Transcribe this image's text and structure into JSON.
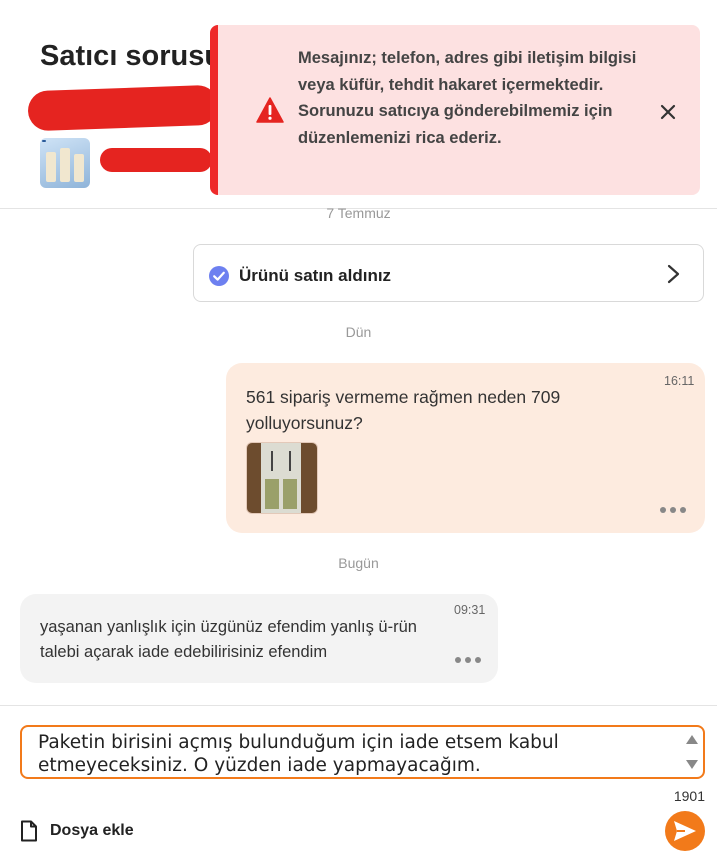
{
  "header": {
    "title": "Satıcı sorusu"
  },
  "alert": {
    "message": "Mesajınız; telefon, adres gibi iletişim bilgisi veya küfür, tehdit hakaret içermektedir. Sorunuzu satıcıya gönderebilmemiz için düzenlemenizi rica ederiz.",
    "icon": "warning-icon",
    "close_icon": "close-icon",
    "accent_color": "#ee2a2a",
    "background_color": "#fde1e1"
  },
  "conversation": {
    "dates": {
      "first": "7 Temmuz",
      "second": "Dün",
      "third": "Bugün"
    },
    "purchase": {
      "label": "Ürünü satın aldınız",
      "icon": "check-circle-icon"
    },
    "outgoing": {
      "time": "16:11",
      "text": "561 sipariş vermeme rağmen neden 709 yolluyorsunuz?"
    },
    "incoming": {
      "time": "09:31",
      "text": "yaşanan yanlışlık için üzgünüz efendim yanlış ü-rün talebi açarak iade edebilirisiniz efendim"
    }
  },
  "composer": {
    "text": "Paketin birisini açmış bulunduğum için iade etsem kabul etmeyeceksiniz. O yüzden iade yapmayacağım.",
    "char_counter": "1901",
    "attach_label": "Dosya ekle",
    "send_icon": "send-icon",
    "accent_color": "#f27a1a"
  }
}
